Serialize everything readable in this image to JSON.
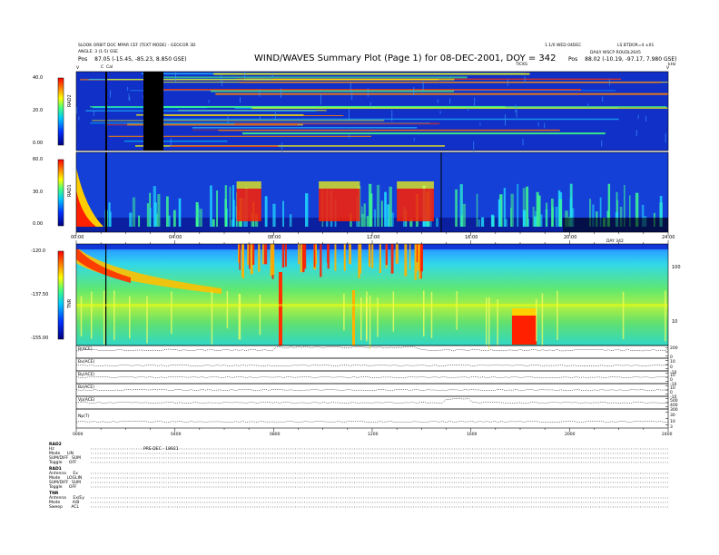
{
  "header": {
    "title": "WIND/WAVES Summary Plot (Page 1) for 08-DEC-2001, DOY = 342",
    "left_line1": "SLOOK ORBIT DOC MPAR CEF (TEXT MODE) - GEOCOR 3D",
    "left_line2": "ANGLE: 3 (1-5)  GSE",
    "left_pos_label": "Pos",
    "left_pos_value": "87.05 (-15.45, -85.23, 8.850 GSE)",
    "right_line0a": "1.1/0 WED 04DEC",
    "right_line0b": "LS BTDOR=4 ±01",
    "right_line1": "DAILY WSCP ROUDL2645",
    "right_pos_label": "Pos",
    "right_pos_value": "88.02 (-10.19, -97.17, 7.980 GSE)",
    "ticks_label": "TICKS",
    "khz_label": "kHz",
    "marker_v": "V",
    "marker_c": "C",
    "marker_cal": "Cal"
  },
  "chart_data": [
    {
      "type": "heatmap",
      "name_label": "RAD2",
      "ylim": [
        0,
        40
      ],
      "yticks": [
        "40.0",
        "20.0",
        "0.00"
      ],
      "notes": "Dynamic spectrum, horizontal interference bands, black data gap near 03:00"
    },
    {
      "type": "heatmap",
      "name_label": "RAD1",
      "ylim": [
        0,
        60
      ],
      "yticks": [
        "60.0",
        "30.0",
        "0.00"
      ],
      "bursts": [
        {
          "start": "06:30",
          "end": "07:30",
          "intensity": "high"
        },
        {
          "start": "09:50",
          "end": "11:30",
          "intensity": "high"
        },
        {
          "start": "13:00",
          "end": "14:30",
          "intensity": "high"
        }
      ]
    },
    {
      "type": "heatmap",
      "name_label": "TNR",
      "ylim": [
        -155,
        -120
      ],
      "yticks": [
        "-120.0",
        "-137.50",
        "-155.00"
      ],
      "right_ticks": [
        "100",
        "10"
      ],
      "bursts": [
        {
          "start": "06:30",
          "end": "14:00",
          "intensity": "high"
        },
        {
          "start": "17:40",
          "end": "18:40",
          "intensity": "high"
        }
      ]
    },
    {
      "type": "line",
      "name_label": "B(ACE)",
      "right_ticks": [
        "200",
        "0"
      ]
    },
    {
      "type": "line",
      "name_label": "Bx(ACE)",
      "right_ticks": [
        "10",
        "0",
        "-10"
      ]
    },
    {
      "type": "line",
      "name_label": "By(ACE)",
      "right_ticks": [
        "10",
        "0",
        "-10"
      ]
    },
    {
      "type": "line",
      "name_label": "Bz(ACE)",
      "right_ticks": [
        "10",
        "0",
        "-10"
      ]
    },
    {
      "type": "line",
      "name_label": "Vp(ACE)",
      "right_ticks": [
        "500",
        "400",
        "300"
      ]
    },
    {
      "type": "line",
      "name_label": "Np(T)",
      "right_ticks": [
        "30",
        "10",
        "3"
      ]
    }
  ],
  "time_axis": {
    "ticks": [
      "00:00",
      "04:00",
      "08:00",
      "12:00",
      "16:00",
      "20:00",
      "24:00"
    ],
    "doy_label": "DAY 342"
  },
  "bottom_time_axis": {
    "ticks": [
      "0000",
      "0400",
      "0800",
      "1200",
      "1600",
      "2000",
      "2400"
    ]
  },
  "footer": {
    "rad2_title": "RAD2",
    "rad2_rows": [
      {
        "label": "Hz",
        "value": ""
      },
      {
        "label": "Mode",
        "value": "LIN"
      },
      {
        "label": "SUM/DIFF",
        "value": "SUM"
      },
      {
        "label": "Toggle",
        "value": "OFF"
      }
    ],
    "rad2_note": "PRE-DEC - 18921",
    "rad1_title": "RAD1",
    "rad1_rows": [
      {
        "label": "Antenna",
        "value": "Ex"
      },
      {
        "label": "Mode",
        "value": "LOGLIN"
      },
      {
        "label": "SUM/DIFF",
        "value": "SUM"
      },
      {
        "label": "Toggle",
        "value": "OFF"
      }
    ],
    "tnr_title": "TNR",
    "tnr_rows": [
      {
        "label": "Antenna",
        "value": "Ex/Ey"
      },
      {
        "label": "Mode",
        "value": "A/B"
      },
      {
        "label": "Sweep",
        "value": "ACL"
      }
    ]
  }
}
